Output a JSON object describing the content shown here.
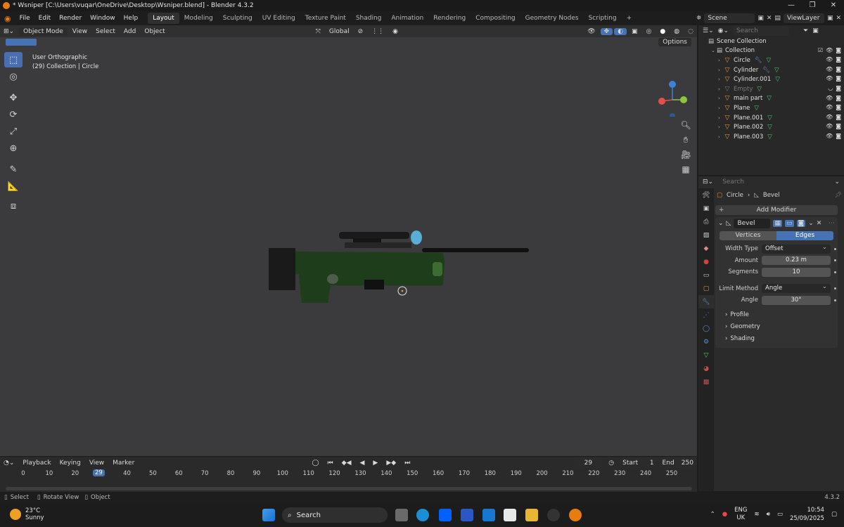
{
  "title_bar": {
    "title": "* Wsniper [C:\\Users\\vuqar\\OneDrive\\Desktop\\Wsniper.blend] - Blender 4.3.2",
    "controls": [
      "—",
      "❐",
      "✕"
    ]
  },
  "menu": [
    "File",
    "Edit",
    "Render",
    "Window",
    "Help"
  ],
  "workspaces": [
    "Layout",
    "Modeling",
    "Sculpting",
    "UV Editing",
    "Texture Paint",
    "Shading",
    "Animation",
    "Rendering",
    "Compositing",
    "Geometry Nodes",
    "Scripting"
  ],
  "active_workspace": "Layout",
  "scene": {
    "scene_name": "Scene",
    "view_layer": "ViewLayer"
  },
  "viewport": {
    "mode": "Object Mode",
    "menus": [
      "View",
      "Select",
      "Add",
      "Object"
    ],
    "transform_orientation": "Global",
    "options_label": "Options",
    "info_line1": "User Orthographic",
    "info_line2": "(29) Collection | Circle",
    "gizmo_axes": {
      "x": "#e84d4d",
      "y": "#8cc63f",
      "z": "#3a83d7"
    }
  },
  "outliner": {
    "search_placeholder": "Search",
    "scene_collection": "Scene Collection",
    "collection": "Collection",
    "items": [
      {
        "name": "Circle",
        "has_modifier": true,
        "dim": false
      },
      {
        "name": "Cylinder",
        "has_modifier": true,
        "dim": false
      },
      {
        "name": "Cylinder.001",
        "has_modifier": false,
        "dim": false
      },
      {
        "name": "Empty",
        "has_modifier": false,
        "dim": true
      },
      {
        "name": "main part",
        "has_modifier": false,
        "dim": false
      },
      {
        "name": "Plane",
        "has_modifier": false,
        "dim": false
      },
      {
        "name": "Plane.001",
        "has_modifier": false,
        "dim": false
      },
      {
        "name": "Plane.002",
        "has_modifier": false,
        "dim": false
      },
      {
        "name": "Plane.003",
        "has_modifier": false,
        "dim": false
      }
    ]
  },
  "properties": {
    "search_placeholder": "Search",
    "breadcrumb_object": "Circle",
    "breadcrumb_modifier": "Bevel",
    "add_modifier": "Add Modifier",
    "modifier_name": "Bevel",
    "affect_tabs": [
      "Vertices",
      "Edges"
    ],
    "active_affect": "Edges",
    "fields": [
      {
        "label": "Width Type",
        "value": "Offset",
        "kind": "select"
      },
      {
        "label": "Amount",
        "value": "0.23 m",
        "kind": "number"
      },
      {
        "label": "Segments",
        "value": "10",
        "kind": "number"
      }
    ],
    "fields2": [
      {
        "label": "Limit Method",
        "value": "Angle",
        "kind": "select"
      },
      {
        "label": "Angle",
        "value": "30°",
        "kind": "number"
      }
    ],
    "sections": [
      "Profile",
      "Geometry",
      "Shading"
    ]
  },
  "timeline": {
    "menus": [
      "Playback",
      "Keying",
      "View",
      "Marker"
    ],
    "current_frame": "29",
    "start_label": "Start",
    "start": "1",
    "end_label": "End",
    "end": "250",
    "ticks": [
      "0",
      "10",
      "20",
      "29",
      "40",
      "50",
      "60",
      "70",
      "80",
      "90",
      "100",
      "110",
      "120",
      "130",
      "140",
      "150",
      "160",
      "170",
      "180",
      "190",
      "200",
      "210",
      "220",
      "230",
      "240",
      "250"
    ]
  },
  "status": {
    "select": "Select",
    "rotate": "Rotate View",
    "object": "Object",
    "version": "4.3.2"
  },
  "taskbar": {
    "temperature": "23°C",
    "weather": "Sunny",
    "search": "Search",
    "lang1": "ENG",
    "lang2": "UK",
    "time": "10:54",
    "date": "25/09/2025"
  }
}
